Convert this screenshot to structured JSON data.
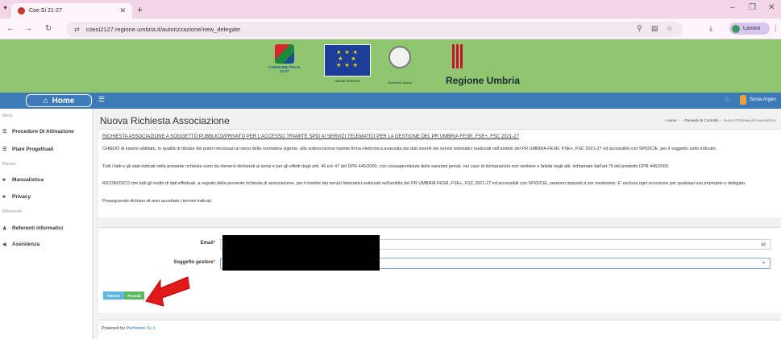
{
  "browser": {
    "tab_title": "Coe.Si 21-27",
    "url": "coesi2127.regione.umbria.it/autorizzazione/new_delegate",
    "profile_label": "Lavoro",
    "profile_initial": "S"
  },
  "banner": {
    "coesione_text": "COESIONE ITALIA 21-27",
    "eu_caption": "UNIONE EUROPEA",
    "repubblica_caption": "Repubblica Italiana",
    "region_title": "Regione Umbria"
  },
  "topbar": {
    "home_label": "Home",
    "user_name": "Sonia Argen"
  },
  "sidebar": {
    "menu_heading": "Menù",
    "items_menu": [
      {
        "icon": "list-icon",
        "label": "Procedure Di Attivazione"
      },
      {
        "icon": "list-icon",
        "label": "Piani Progettuali"
      }
    ],
    "resources_heading": "Risorse",
    "items_resources": [
      {
        "icon": "folder-icon",
        "label": "Manualistica"
      },
      {
        "icon": "folder-icon",
        "label": "Privacy"
      }
    ],
    "contacts_heading": "Riferimenti",
    "items_contacts": [
      {
        "icon": "user-icon",
        "label": "Referenti informatici"
      },
      {
        "icon": "megaphone-icon",
        "label": "Assistenza"
      }
    ]
  },
  "page": {
    "title": "Nuova Richiesta Associazione",
    "breadcrumb": [
      "Home",
      "Pannello di Controllo",
      "Nuova Richiesta di Associazione"
    ]
  },
  "request": {
    "heading": "RICHIESTA ASSOCIAZIONE A SOGGETTO PUBBLICO/PRIVATO PER L'ACCESSO TRAMITE SPID AI SERVIZI TELEMATICI PER LA GESTIONE DEL PR UMBRIA FESR, FSE+, FSC 2021-27",
    "para1": "CHIEDO di essere abilitato, in qualità di titolare dei poteri necessari ai sensi della normativa vigente, alla sottoscrizione tramite firma elettronica avanzata dei dati inseriti nei servizi telematici realizzati nell'ambito del PR UMBRIA FESR, FSE+, FSC 2021-27 ed accessibili con SPID/CIE, per il soggetto sotto indicato.",
    "para2": "Tutti i fatti e gli stati indicati nella presente richiesta sono da ritenersi dichiarati ai sensi e per gli effetti degli artt. 46 e/o 47 del DPR 445/2000, con consapevolezza delle sanzioni penali, nel caso di dichiarazioni non veritiere e falsità negli atti, richiamate dall'art.76 del predetto DPR 445/2000.",
    "para3": "RICONOSCO che tutti gli inoltri di dati effettuati, a seguito della presente richiesta di associazione, per il tramite dei servizi telematici realizzati nell'ambito del PR UMBRIA FESR, FSE+, FSC 2021-27 ed accessibili con SPID/CIE,  saranno imputati a me medesimo. E' esclusa ogni eccezione per qualsiasi uso improprio o delegato.",
    "para4": "Proseguendo dichiaro di aver accettato i termini indicati."
  },
  "form": {
    "email_label": "Email",
    "soggetto_label": "Soggetto gestore",
    "required_mark": "*",
    "back_button": "Ritorna",
    "next_button": "Procedi"
  },
  "footer": {
    "powered_prefix": "Powered by ",
    "company": "Performer S.r.l."
  },
  "colors": {
    "banner": "#8fc66f",
    "topbar": "#3d7ab8",
    "back_btn": "#5fb4e0",
    "next_btn": "#5cb85c",
    "arrow": "#e0191b"
  }
}
